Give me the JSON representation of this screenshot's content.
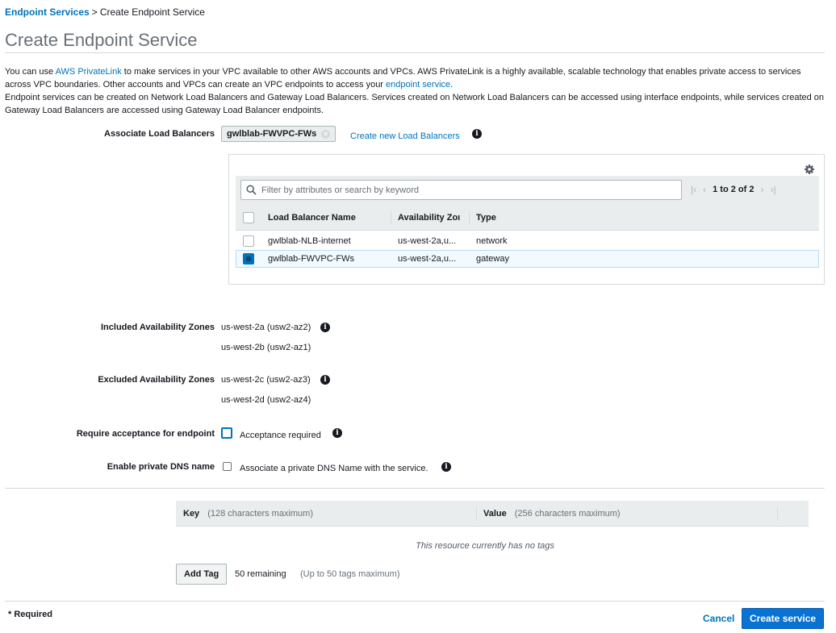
{
  "breadcrumb": {
    "link": "Endpoint Services",
    "separator": ">",
    "current": "Create Endpoint Service"
  },
  "page_title": "Create Endpoint Service",
  "intro": {
    "p1_a": "You can use",
    "p1_link1": "AWS PrivateLink",
    "p1_b": "to make services in your VPC available to other AWS accounts and VPCs. AWS PrivateLink is a highly available, scalable technology that enables private access to services across VPC boundaries. Other accounts and VPCs can create an VPC endpoints to access your",
    "p1_link2": "endpoint service",
    "p1_c": ".",
    "p2": "Endpoint services can be created on Network Load Balancers and Gateway Load Balancers. Services created on Network Load Balancers can be accessed using interface endpoints, while services created on Gateway Load Balancers are accessed using Gateway Load Balancer endpoints."
  },
  "associate": {
    "label": "Associate Load Balancers",
    "chip": "gwlblab-FWVPC-FWs",
    "create_link": "Create new Load Balancers"
  },
  "lb_table": {
    "search_placeholder": "Filter by attributes or search by keyword",
    "pager_text": "1 to 2 of 2",
    "columns": [
      "Load Balancer Name",
      "Availability Zoı",
      "Type"
    ],
    "rows": [
      {
        "name": "gwlblab-NLB-internet",
        "az": "us-west-2a,u...",
        "type": "network",
        "selected": false
      },
      {
        "name": "gwlblab-FWVPC-FWs",
        "az": "us-west-2a,u...",
        "type": "gateway",
        "selected": true
      }
    ]
  },
  "included_az": {
    "label": "Included Availability Zones",
    "values": [
      "us-west-2a (usw2-az2)",
      "us-west-2b (usw2-az1)"
    ]
  },
  "excluded_az": {
    "label": "Excluded Availability Zones",
    "values": [
      "us-west-2c (usw2-az3)",
      "us-west-2d (usw2-az4)"
    ]
  },
  "acceptance": {
    "label": "Require acceptance for endpoint",
    "option": "Acceptance required"
  },
  "private_dns": {
    "label": "Enable private DNS name",
    "option": "Associate a private DNS Name with the service."
  },
  "tags": {
    "key_label": "Key",
    "key_hint": "(128 characters maximum)",
    "value_label": "Value",
    "value_hint": "(256 characters maximum)",
    "empty_text": "This resource currently has no tags",
    "add_button": "Add Tag",
    "remaining": "50 remaining",
    "limit_hint": "(Up to 50 tags maximum)"
  },
  "footer": {
    "required_note": "* Required",
    "cancel": "Cancel",
    "create": "Create service"
  },
  "colors": {
    "link": "#0073bb",
    "primary_button": "#0972d3",
    "title_gray": "#687078",
    "header_bg": "#eaeded",
    "selected_row": "#f1faff"
  }
}
